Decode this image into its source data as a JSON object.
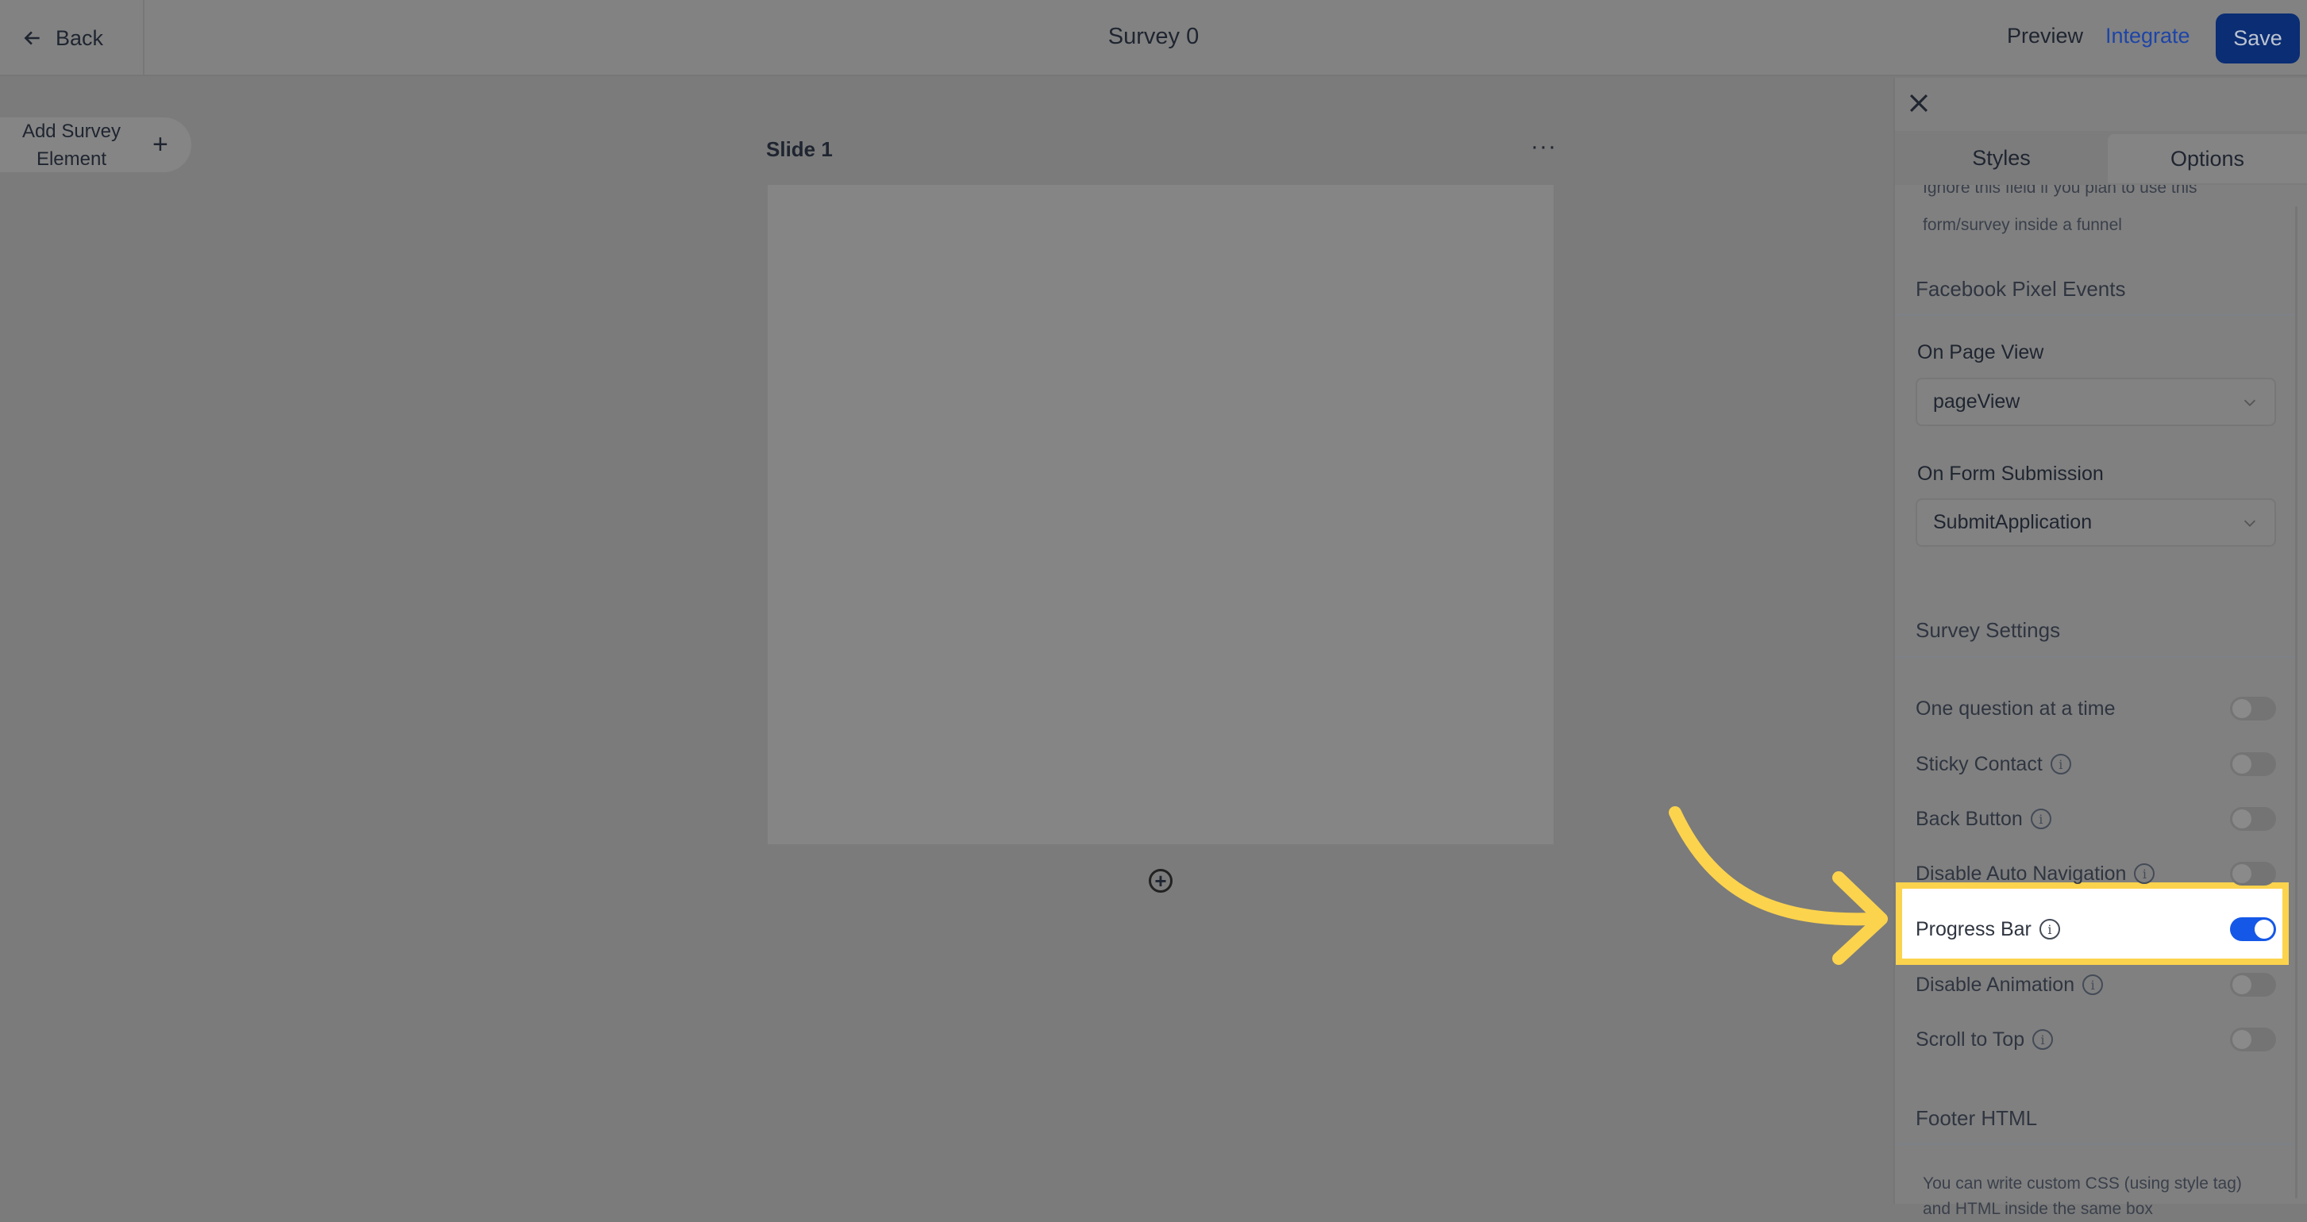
{
  "header": {
    "back_label": "Back",
    "title": "Survey 0",
    "preview_label": "Preview",
    "integrate_label": "Integrate",
    "save_label": "Save"
  },
  "canvas": {
    "add_element_label": "Add Survey Element",
    "slide_label": "Slide 1",
    "slide_menu": "···",
    "add_slide": "+"
  },
  "panel": {
    "tabs": [
      {
        "label": "Styles",
        "active": false
      },
      {
        "label": "Options",
        "active": true
      }
    ],
    "truncated_help_top": "Ignore this field if you plan to use this",
    "truncated_help_bottom": "form/survey inside a funnel",
    "facebook_header": "Facebook Pixel Events",
    "on_page_view_label": "On Page View",
    "on_page_view_value": "pageView",
    "on_form_submission_label": "On Form Submission",
    "on_form_submission_value": "SubmitApplication",
    "survey_settings_header": "Survey Settings",
    "settings": [
      {
        "label": "One question at a time",
        "info": false,
        "on": false
      },
      {
        "label": "Sticky Contact",
        "info": true,
        "on": false
      },
      {
        "label": "Back Button",
        "info": true,
        "on": false
      },
      {
        "label": "Disable Auto Navigation",
        "info": true,
        "on": false
      },
      {
        "label": "Progress Bar",
        "info": true,
        "on": true
      },
      {
        "label": "Disable Animation",
        "info": true,
        "on": false
      },
      {
        "label": "Scroll to Top",
        "info": true,
        "on": false
      }
    ],
    "footer_header": "Footer HTML",
    "footer_help": "You can write custom CSS (using style tag) and HTML inside the same box"
  },
  "colors": {
    "accent": "#1558e8",
    "save": "#0a2d74",
    "integrate": "#1d45a8",
    "highlight": "#fcd34d"
  },
  "icons": {
    "back": "arrow-left-icon",
    "close": "close-icon",
    "info": "info-icon",
    "chevron": "chevron-down-icon",
    "add": "plus-circle-icon",
    "annotation": "arrow-annotation"
  }
}
